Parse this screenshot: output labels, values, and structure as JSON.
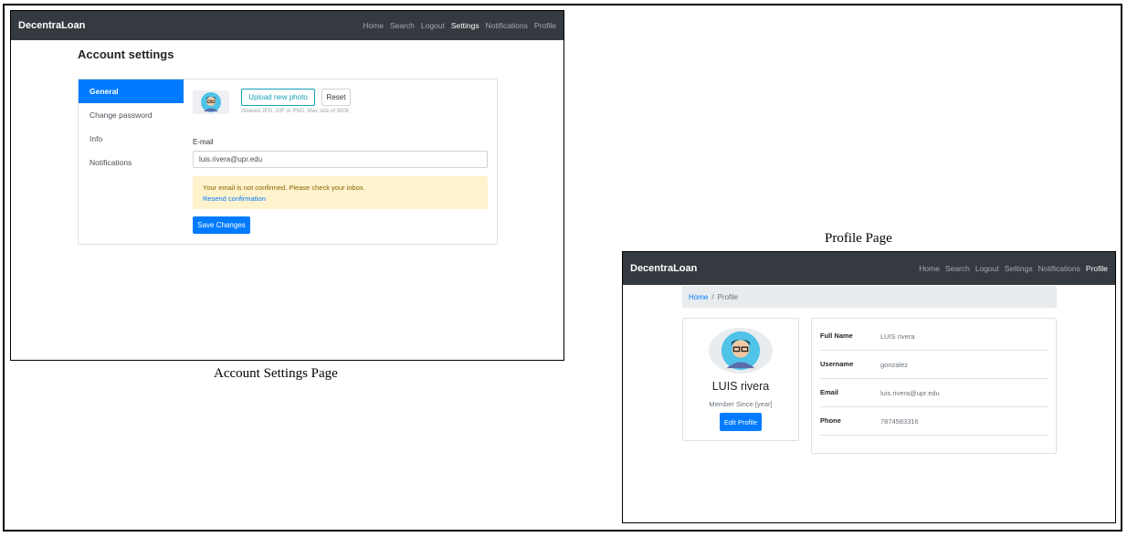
{
  "colors": {
    "navbar_bg": "#343a40",
    "primary": "#007bff",
    "info": "#17a2b8",
    "alert_bg": "#fff3cd",
    "alert_text": "#856404",
    "breadcrumb_bg": "#e9ecef"
  },
  "settings_page": {
    "brand": "DecentraLoan",
    "nav": [
      {
        "label": "Home"
      },
      {
        "label": "Search"
      },
      {
        "label": "Logout"
      },
      {
        "label": "Settings",
        "active": true
      },
      {
        "label": "Notifications"
      },
      {
        "label": "Profile"
      }
    ],
    "title": "Account settings",
    "menu": [
      {
        "label": "General",
        "active": true
      },
      {
        "label": "Change password"
      },
      {
        "label": "Info"
      },
      {
        "label": "Notifications"
      }
    ],
    "avatar_icon": "user-avatar-icon",
    "upload_button": "Upload new photo",
    "reset_button": "Reset",
    "upload_hint": "Allowed JPG, GIF or PNG. Max size of 800K",
    "email_label": "E-mail",
    "email_value": "luis.rivera@upr.edu",
    "alert_text": "Your email is not confirmed. Please check your inbox.",
    "alert_link": "Resend confirmation",
    "save_button": "Save Changes"
  },
  "settings_caption": "Account Settings Page",
  "profile_caption": "Profile Page",
  "profile_page": {
    "brand": "DecentraLoan",
    "nav": [
      {
        "label": "Home"
      },
      {
        "label": "Search"
      },
      {
        "label": "Logout"
      },
      {
        "label": "Settings"
      },
      {
        "label": "Notifications"
      },
      {
        "label": "Profile",
        "active": true
      }
    ],
    "breadcrumb": {
      "home": "Home",
      "separator": "/",
      "current": "Profile"
    },
    "avatar_icon": "user-avatar-icon",
    "name": "LUIS rivera",
    "member_since": "Member Since [year]",
    "edit_button": "Edit Profile",
    "details": [
      {
        "label": "Full Name",
        "value": "LUIS rivera"
      },
      {
        "label": "Username",
        "value": "gonzalez"
      },
      {
        "label": "Email",
        "value": "luis.rivera@upr.edu"
      },
      {
        "label": "Phone",
        "value": "7874583316"
      }
    ]
  }
}
